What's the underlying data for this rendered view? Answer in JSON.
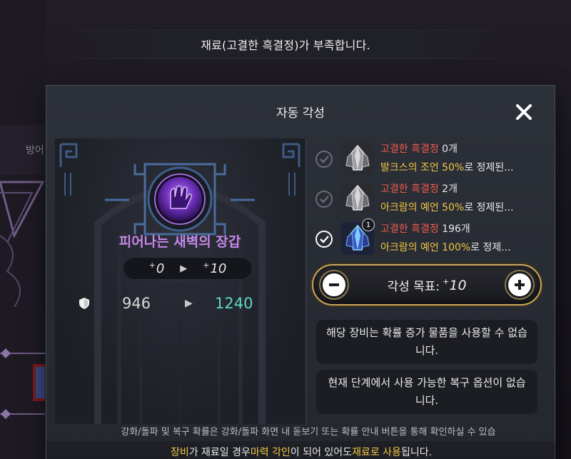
{
  "toast": {
    "message": "재료(고결한 흑결정)가 부족합니다."
  },
  "background": {
    "side_label": "방어",
    "ghost_title": "피어나는 새벽의 장갑"
  },
  "dialog": {
    "title": "자동 각성",
    "close_icon": "close-icon"
  },
  "item": {
    "name": "피어나는 새벽의 장갑",
    "level_from_prefix": "+",
    "level_from": "0",
    "level_to_prefix": "+",
    "level_to": "10",
    "stat_icon": "shield-icon",
    "stat_from": "946",
    "stat_to": "1240"
  },
  "materials": [
    {
      "checked": false,
      "name": "고결한 흑결정",
      "count": " 0개",
      "source": "발크스의 조언 50%",
      "suffix": "로 정제된...",
      "badge": ""
    },
    {
      "checked": false,
      "name": "고결한 흑결정",
      "count": " 2개",
      "source": "아크람의 예언 50%",
      "suffix": "로 정제된...",
      "badge": ""
    },
    {
      "checked": true,
      "name": "고결한 흑결정",
      "count": " 196개",
      "source": "아크람의 예언 100%",
      "suffix": "로 정제...",
      "badge": "1"
    }
  ],
  "target": {
    "label": "각성 목표:",
    "level_prefix": "+",
    "level": "10"
  },
  "info": {
    "box1": "해당 장비는 확률 증가 물품을 사용할 수 없습니다.",
    "box2": "현재 단계에서 사용 가능한 복구 옵션이 없습니다."
  },
  "footer": {
    "note": "강화/돌파 및 복구 확률은 강화/돌파 화면 내 돋보기 또는 확률 안내 버튼을 통해 확인하실 수 있습",
    "bar_part1": "장비",
    "bar_part2": "가 재료일 경우 ",
    "bar_part3": "마력 각인",
    "bar_part4": "이 되어 있어도 ",
    "bar_part5": "재료로 사용",
    "bar_part6": "됩니다."
  },
  "colors": {
    "accent_gold": "#c9a85c",
    "item_name": "#c586e9",
    "stat_up": "#5fd9c4",
    "red": "#f05a4f",
    "yellow": "#f2c744"
  }
}
